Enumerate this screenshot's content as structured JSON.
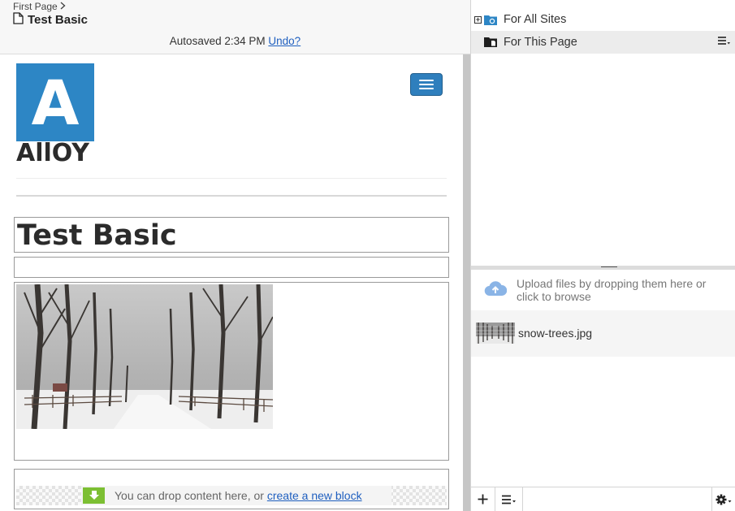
{
  "header": {
    "breadcrumb": "First Page",
    "page_title": "Test Basic",
    "autosave_text": "Autosaved 2:34 PM",
    "undo_link": "Undo?"
  },
  "site": {
    "logo_letter": "A",
    "logo_text": "AllOY"
  },
  "content": {
    "page_heading": "Test Basic",
    "drop_text": "You can drop content here, or",
    "create_block_link": "create a new block"
  },
  "assets": {
    "tree": [
      {
        "label": "For All Sites"
      },
      {
        "label": "For This Page"
      }
    ],
    "upload_text": "Upload files by dropping them here or click to browse",
    "files": [
      {
        "name": "snow-trees.jpg"
      }
    ]
  },
  "colors": {
    "brand_blue": "#2d86c5",
    "drop_green": "#7cbf33",
    "link": "#1f5fbf"
  },
  "icons": [
    "document-icon",
    "chevron-right-icon",
    "hamburger-menu-icon",
    "folder-icon",
    "cloud-upload-icon",
    "plus-icon",
    "list-menu-icon",
    "gear-icon",
    "download-arrow-icon"
  ]
}
